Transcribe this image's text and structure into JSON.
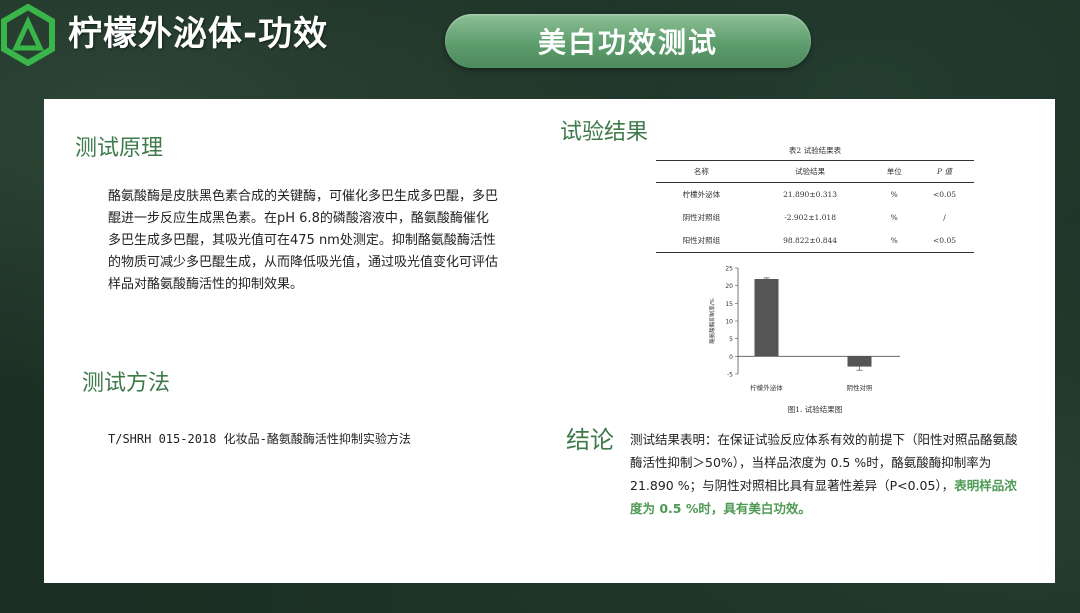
{
  "header": {
    "title": "柠檬外泌体-功效",
    "pill_label": "美白功效测试"
  },
  "colors": {
    "accent_green": "#3f7a4a",
    "highlight_green": "#4f9a55",
    "pill_green": "#5e9d6d",
    "bar_color": "#555555"
  },
  "principle": {
    "heading": "测试原理",
    "text": "酪氨酸酶是皮肤黑色素合成的关键酶，可催化多巴生成多巴醌，多巴醌进一步反应生成黑色素。在pH 6.8的磷酸溶液中，酪氨酸酶催化多巴生成多巴醌，其吸光值可在475 nm处测定。抑制酪氨酸酶活性的物质可减少多巴醌生成，从而降低吸光值，通过吸光值变化可评估样品对酪氨酸酶活性的抑制效果。"
  },
  "method": {
    "heading": "测试方法",
    "text": "T/SHRH 015-2018 化妆品-酪氨酸酶活性抑制实验方法"
  },
  "results": {
    "heading": "试验结果",
    "table_caption": "表2 试验结果表",
    "columns": [
      "名称",
      "试验结果",
      "单位",
      "P 值"
    ],
    "rows": [
      [
        "柠檬外泌体",
        "21.890±0.313",
        "%",
        "<0.05"
      ],
      [
        "阴性对照组",
        "-2.902±1.018",
        "%",
        "/"
      ],
      [
        "阳性对照组",
        "98.822±0.844",
        "%",
        "<0.05"
      ]
    ],
    "chart_caption": "图1. 试验结果图"
  },
  "chart_data": {
    "type": "bar",
    "categories": [
      "柠檬外泌体",
      "阴性对照"
    ],
    "values": [
      21.89,
      -2.902
    ],
    "errors": [
      0.313,
      1.018
    ],
    "ylabel": "酪氨酸酶抑制率/%",
    "ylim": [
      -5,
      25
    ],
    "yticks": [
      -5,
      0,
      5,
      10,
      15,
      20,
      25
    ],
    "title": "",
    "xlabel": ""
  },
  "conclusion": {
    "heading": "结论",
    "text_main": "测试结果表明：在保证试验反应体系有效的前提下（阳性对照品酪氨酸酶活性抑制＞50%），当样品浓度为 0.5 %时，酪氨酸酶抑制率为 21.890 %；与阴性对照相比具有显著性差异（P<0.05），",
    "text_highlight": "表明样品浓度为 0.5 %时，具有美白功效。"
  }
}
